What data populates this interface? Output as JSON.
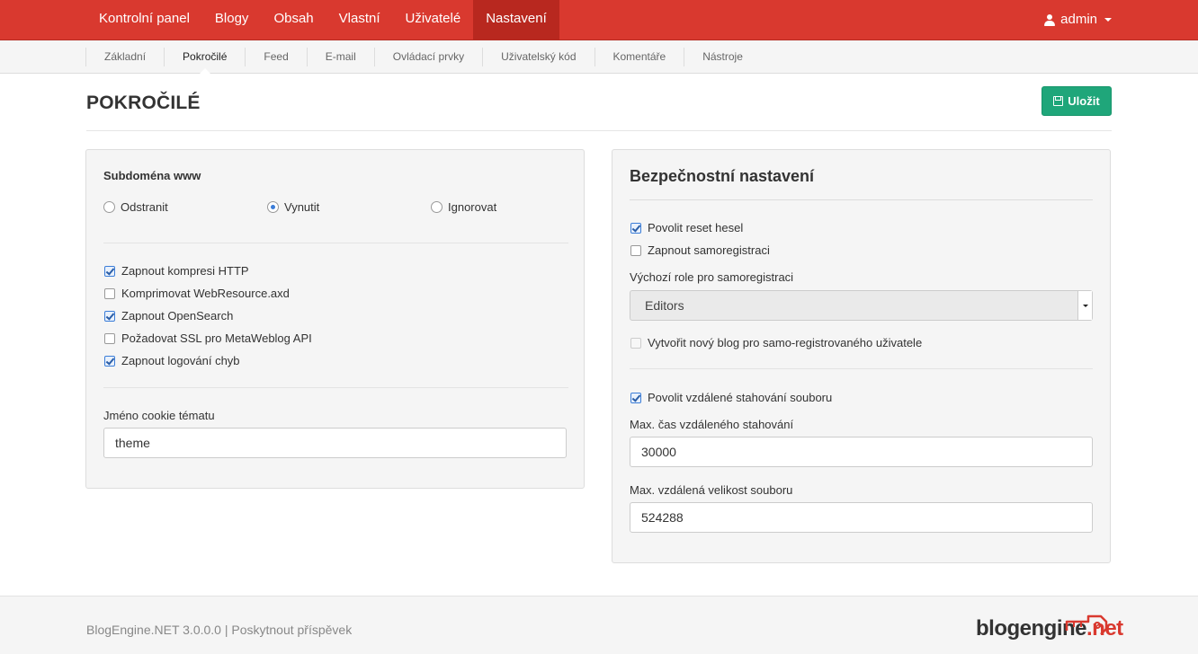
{
  "topnav": {
    "items": [
      {
        "label": "Kontrolní panel"
      },
      {
        "label": "Blogy"
      },
      {
        "label": "Obsah"
      },
      {
        "label": "Vlastní"
      },
      {
        "label": "Uživatelé"
      },
      {
        "label": "Nastavení",
        "active": true
      }
    ],
    "user": "admin"
  },
  "subnav": {
    "tabs": [
      {
        "label": "Základní"
      },
      {
        "label": "Pokročilé",
        "active": true
      },
      {
        "label": "Feed"
      },
      {
        "label": "E-mail"
      },
      {
        "label": "Ovládací prvky"
      },
      {
        "label": "Uživatelský kód"
      },
      {
        "label": "Komentáře"
      },
      {
        "label": "Nástroje"
      }
    ]
  },
  "page": {
    "title": "POKROČILÉ",
    "save_label": "Uložit"
  },
  "left_panel": {
    "subdomain_label": "Subdoména www",
    "radios": [
      {
        "label": "Odstranit",
        "checked": false
      },
      {
        "label": "Vynutit",
        "checked": true
      },
      {
        "label": "Ignorovat",
        "checked": false
      }
    ],
    "checkboxes": [
      {
        "label": "Zapnout kompresi HTTP",
        "checked": true
      },
      {
        "label": "Komprimovat WebResource.axd",
        "checked": false
      },
      {
        "label": "Zapnout OpenSearch",
        "checked": true
      },
      {
        "label": "Požadovat SSL pro MetaWeblog API",
        "checked": false
      },
      {
        "label": "Zapnout logování chyb",
        "checked": true
      }
    ],
    "cookie_label": "Jméno cookie tématu",
    "cookie_value": "theme"
  },
  "right_panel": {
    "heading": "Bezpečnostní nastavení",
    "allow_reset": {
      "label": "Povolit reset hesel",
      "checked": true
    },
    "self_registration": {
      "label": "Zapnout samoregistraci",
      "checked": false
    },
    "default_role_label": "Výchozí role pro samoregistraci",
    "default_role_value": "Editors",
    "new_blog": {
      "label": "Vytvořit nový blog pro samo-registrovaného uživatele",
      "checked": false
    },
    "remote_download": {
      "label": "Povolit vzdálené stahování souboru",
      "checked": true
    },
    "max_time_label": "Max. čas vzdáleného stahování",
    "max_time_value": "30000",
    "max_size_label": "Max. vzdálená velikost souboru",
    "max_size_value": "524288"
  },
  "footer": {
    "text": "BlogEngine.NET 3.0.0.0 | Poskytnout příspěvek",
    "logo_main": "blogengine",
    "logo_suffix": ".net"
  },
  "colors": {
    "brand_red": "#d9392f",
    "save_green": "#1fa67a",
    "check_blue": "#3b7dd8"
  }
}
